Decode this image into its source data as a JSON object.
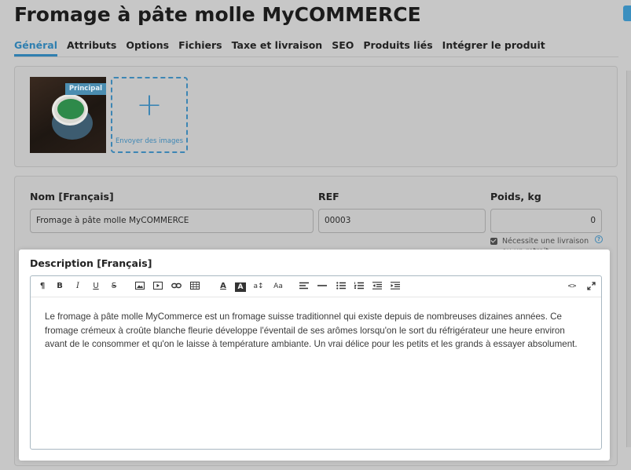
{
  "page": {
    "title": "Fromage à pâte molle MyCOMMERCE"
  },
  "tabs": [
    {
      "label": "Général",
      "active": true
    },
    {
      "label": "Attributs"
    },
    {
      "label": "Options"
    },
    {
      "label": "Fichiers"
    },
    {
      "label": "Taxe et livraison"
    },
    {
      "label": "SEO"
    },
    {
      "label": "Produits liés"
    },
    {
      "label": "Intégrer le produit"
    }
  ],
  "images": {
    "main_badge": "Principal",
    "upload_label": "Envoyer des images",
    "upload_icon": "+"
  },
  "fields": {
    "name_label": "Nom [Français]",
    "name_value": "Fromage à pâte molle MyCOMMERCE",
    "ref_label": "REF",
    "ref_value": "00003",
    "weight_label": "Poids, kg",
    "weight_value": "0",
    "shipping_text": "Nécessite une livraison ou un retrait",
    "shipping_checked": true,
    "help_icon": "?"
  },
  "description": {
    "label": "Description [Français]",
    "text": "Le fromage à pâte molle MyCommerce est un fromage suisse traditionnel qui existe depuis de nombreuses dizaines années. Ce fromage crémeux à croûte blanche fleurie développe l'éventail de ses arômes lorsqu'on le sort du réfrigérateur une heure environ avant de le consommer et qu'on le laisse à température ambiante. Un vrai délice pour les petits et les grands à essayer absolument."
  },
  "toolbar": {
    "paragraph": "¶",
    "bold": "B",
    "italic": "I",
    "underline": "U",
    "strike": "S",
    "font_color": "A",
    "bg_color": "A",
    "font_size": "a↕",
    "font_family": "Aa",
    "code": "<>"
  },
  "colors": {
    "accent": "#2f7fb0",
    "background": "#c7c7c7",
    "editor_bg": "#ffffff"
  }
}
